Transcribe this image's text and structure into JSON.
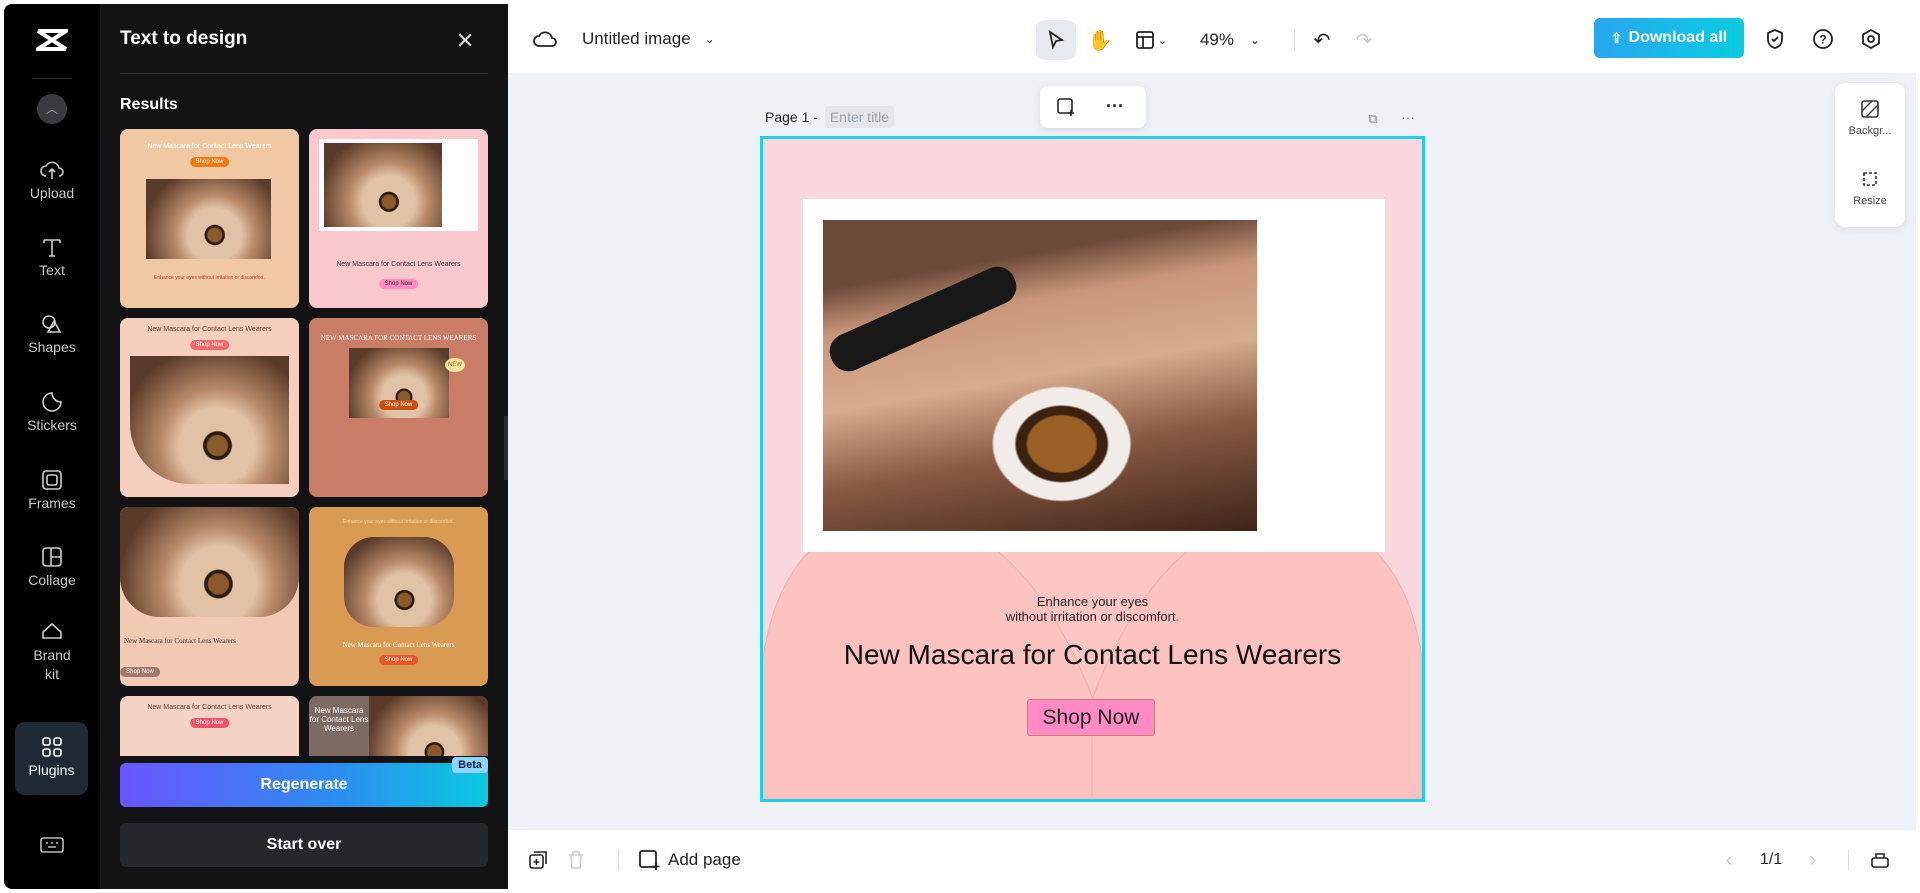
{
  "rail": {
    "items": [
      {
        "label": "Upload",
        "icon": "upload-cloud-icon"
      },
      {
        "label": "Text",
        "icon": "text-icon"
      },
      {
        "label": "Shapes",
        "icon": "shapes-icon"
      },
      {
        "label": "Stickers",
        "icon": "sticker-icon"
      },
      {
        "label": "Frames",
        "icon": "frame-icon"
      },
      {
        "label": "Collage",
        "icon": "collage-icon"
      },
      {
        "label": "Brand kit",
        "icon": "brand-kit-icon"
      },
      {
        "label": "Plugins",
        "icon": "plugins-icon"
      }
    ]
  },
  "panel": {
    "title": "Text to design",
    "results_label": "Results",
    "thumbnails": [
      {
        "headline": "New Mascara for Contact Lens Wearers",
        "button": "Shop Now",
        "sub": "Enhance your eyes without irritation or discomfort."
      },
      {
        "headline": "New Mascara for Contact Lens Wearers",
        "button": "Shop Now",
        "sub": ""
      },
      {
        "headline": "New Mascara for Contact Lens Wearers",
        "button": "Shop Now",
        "sub": ""
      },
      {
        "headline": "NEW MASCARA FOR CONTACT LENS WEARERS",
        "button": "Shop Now",
        "sub": "NEW"
      },
      {
        "headline": "New Mascara for Contact Lens Wearers",
        "button": "Shop Now",
        "sub": ""
      },
      {
        "headline": "New Mascara for Contact Lens Wearers",
        "button": "Shop Now",
        "sub": "Enhance your eyes without irritation or discomfort."
      },
      {
        "headline": "New Mascara for Contact Lens Wearers",
        "button": "Shop Now",
        "sub": ""
      },
      {
        "headline": "New Mascara for Contact Lens Wearers",
        "button": "",
        "sub": ""
      }
    ],
    "regenerate": "Regenerate",
    "beta": "Beta",
    "start_over": "Start over"
  },
  "topbar": {
    "doc_title": "Untitled image",
    "zoom": "49%",
    "download": "Download all"
  },
  "page": {
    "label": "Page 1 -",
    "title_placeholder": "Enter title"
  },
  "design": {
    "subtitle_line1": "Enhance your eyes",
    "subtitle_line2": "without irritation or discomfort.",
    "headline": "New Mascara for Contact Lens Wearers",
    "cta": "Shop Now"
  },
  "float_panel": {
    "background": "Backgr...",
    "resize": "Resize"
  },
  "bottombar": {
    "add_page": "Add page",
    "page_count": "1/1"
  },
  "colors": {
    "accent": "#1fd0e6",
    "design_bg": "#fad7dd",
    "cta": "#ff8ac4"
  }
}
